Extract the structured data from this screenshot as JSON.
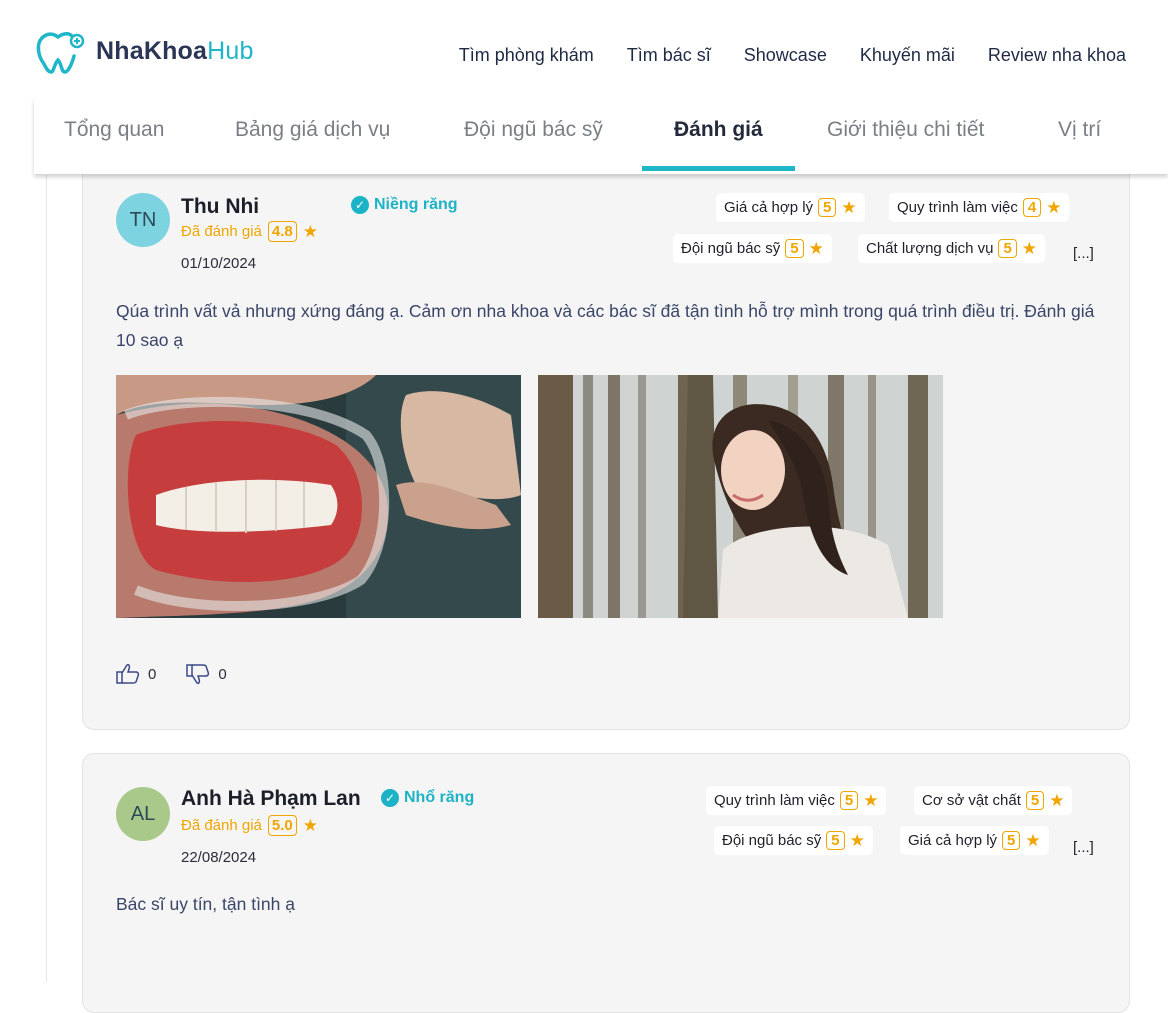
{
  "header": {
    "logo_main": "NhaKhoa",
    "logo_accent": "Hub",
    "nav": [
      "Tìm phòng khám",
      "Tìm bác sĩ",
      "Showcase",
      "Khuyến mãi",
      "Review nha khoa"
    ]
  },
  "tabs": [
    "Tổng quan",
    "Bảng giá dịch vụ",
    "Đội ngũ bác sỹ",
    "Đánh giá",
    "Giới thiệu chi tiết",
    "Vị trí"
  ],
  "active_tab": "Đánh giá",
  "colors": {
    "accent": "#1fb6c8",
    "star": "#f0a500",
    "card_bg": "#f5f5f6"
  },
  "reviews": [
    {
      "initials": "TN",
      "avatar_color": "#7dd3e0",
      "name": "Thu Nhi",
      "rated_label": "Đã đánh giá",
      "rating": "4.8",
      "date": "01/10/2024",
      "service": "Niềng răng",
      "criteria": [
        {
          "label": "Giá cả hợp lý",
          "score": "5"
        },
        {
          "label": "Quy trình làm việc",
          "score": "4"
        },
        {
          "label": "Đội ngũ bác sỹ",
          "score": "5"
        },
        {
          "label": "Chất lượng dịch vụ",
          "score": "5"
        }
      ],
      "more": "[...]",
      "comment": "Qúa trình vất vả nhưng xứng đáng ạ. Cảm ơn nha khoa và các bác sĩ đã tận tình hỗ trợ mình trong quá trình điều trị. Đánh giá 10 sao ạ",
      "likes": "0",
      "dislikes": "0"
    },
    {
      "initials": "AL",
      "avatar_color": "#a8c98a",
      "name": "Anh Hà Phạm Lan",
      "rated_label": "Đã đánh giá",
      "rating": "5.0",
      "date": "22/08/2024",
      "service": "Nhổ răng",
      "criteria": [
        {
          "label": "Quy trình làm việc",
          "score": "5"
        },
        {
          "label": "Cơ sở vật chất",
          "score": "5"
        },
        {
          "label": "Đội ngũ bác sỹ",
          "score": "5"
        },
        {
          "label": "Giá cả hợp lý",
          "score": "5"
        }
      ],
      "more": "[...]",
      "comment": "Bác sĩ uy tín, tận tình ạ"
    }
  ]
}
